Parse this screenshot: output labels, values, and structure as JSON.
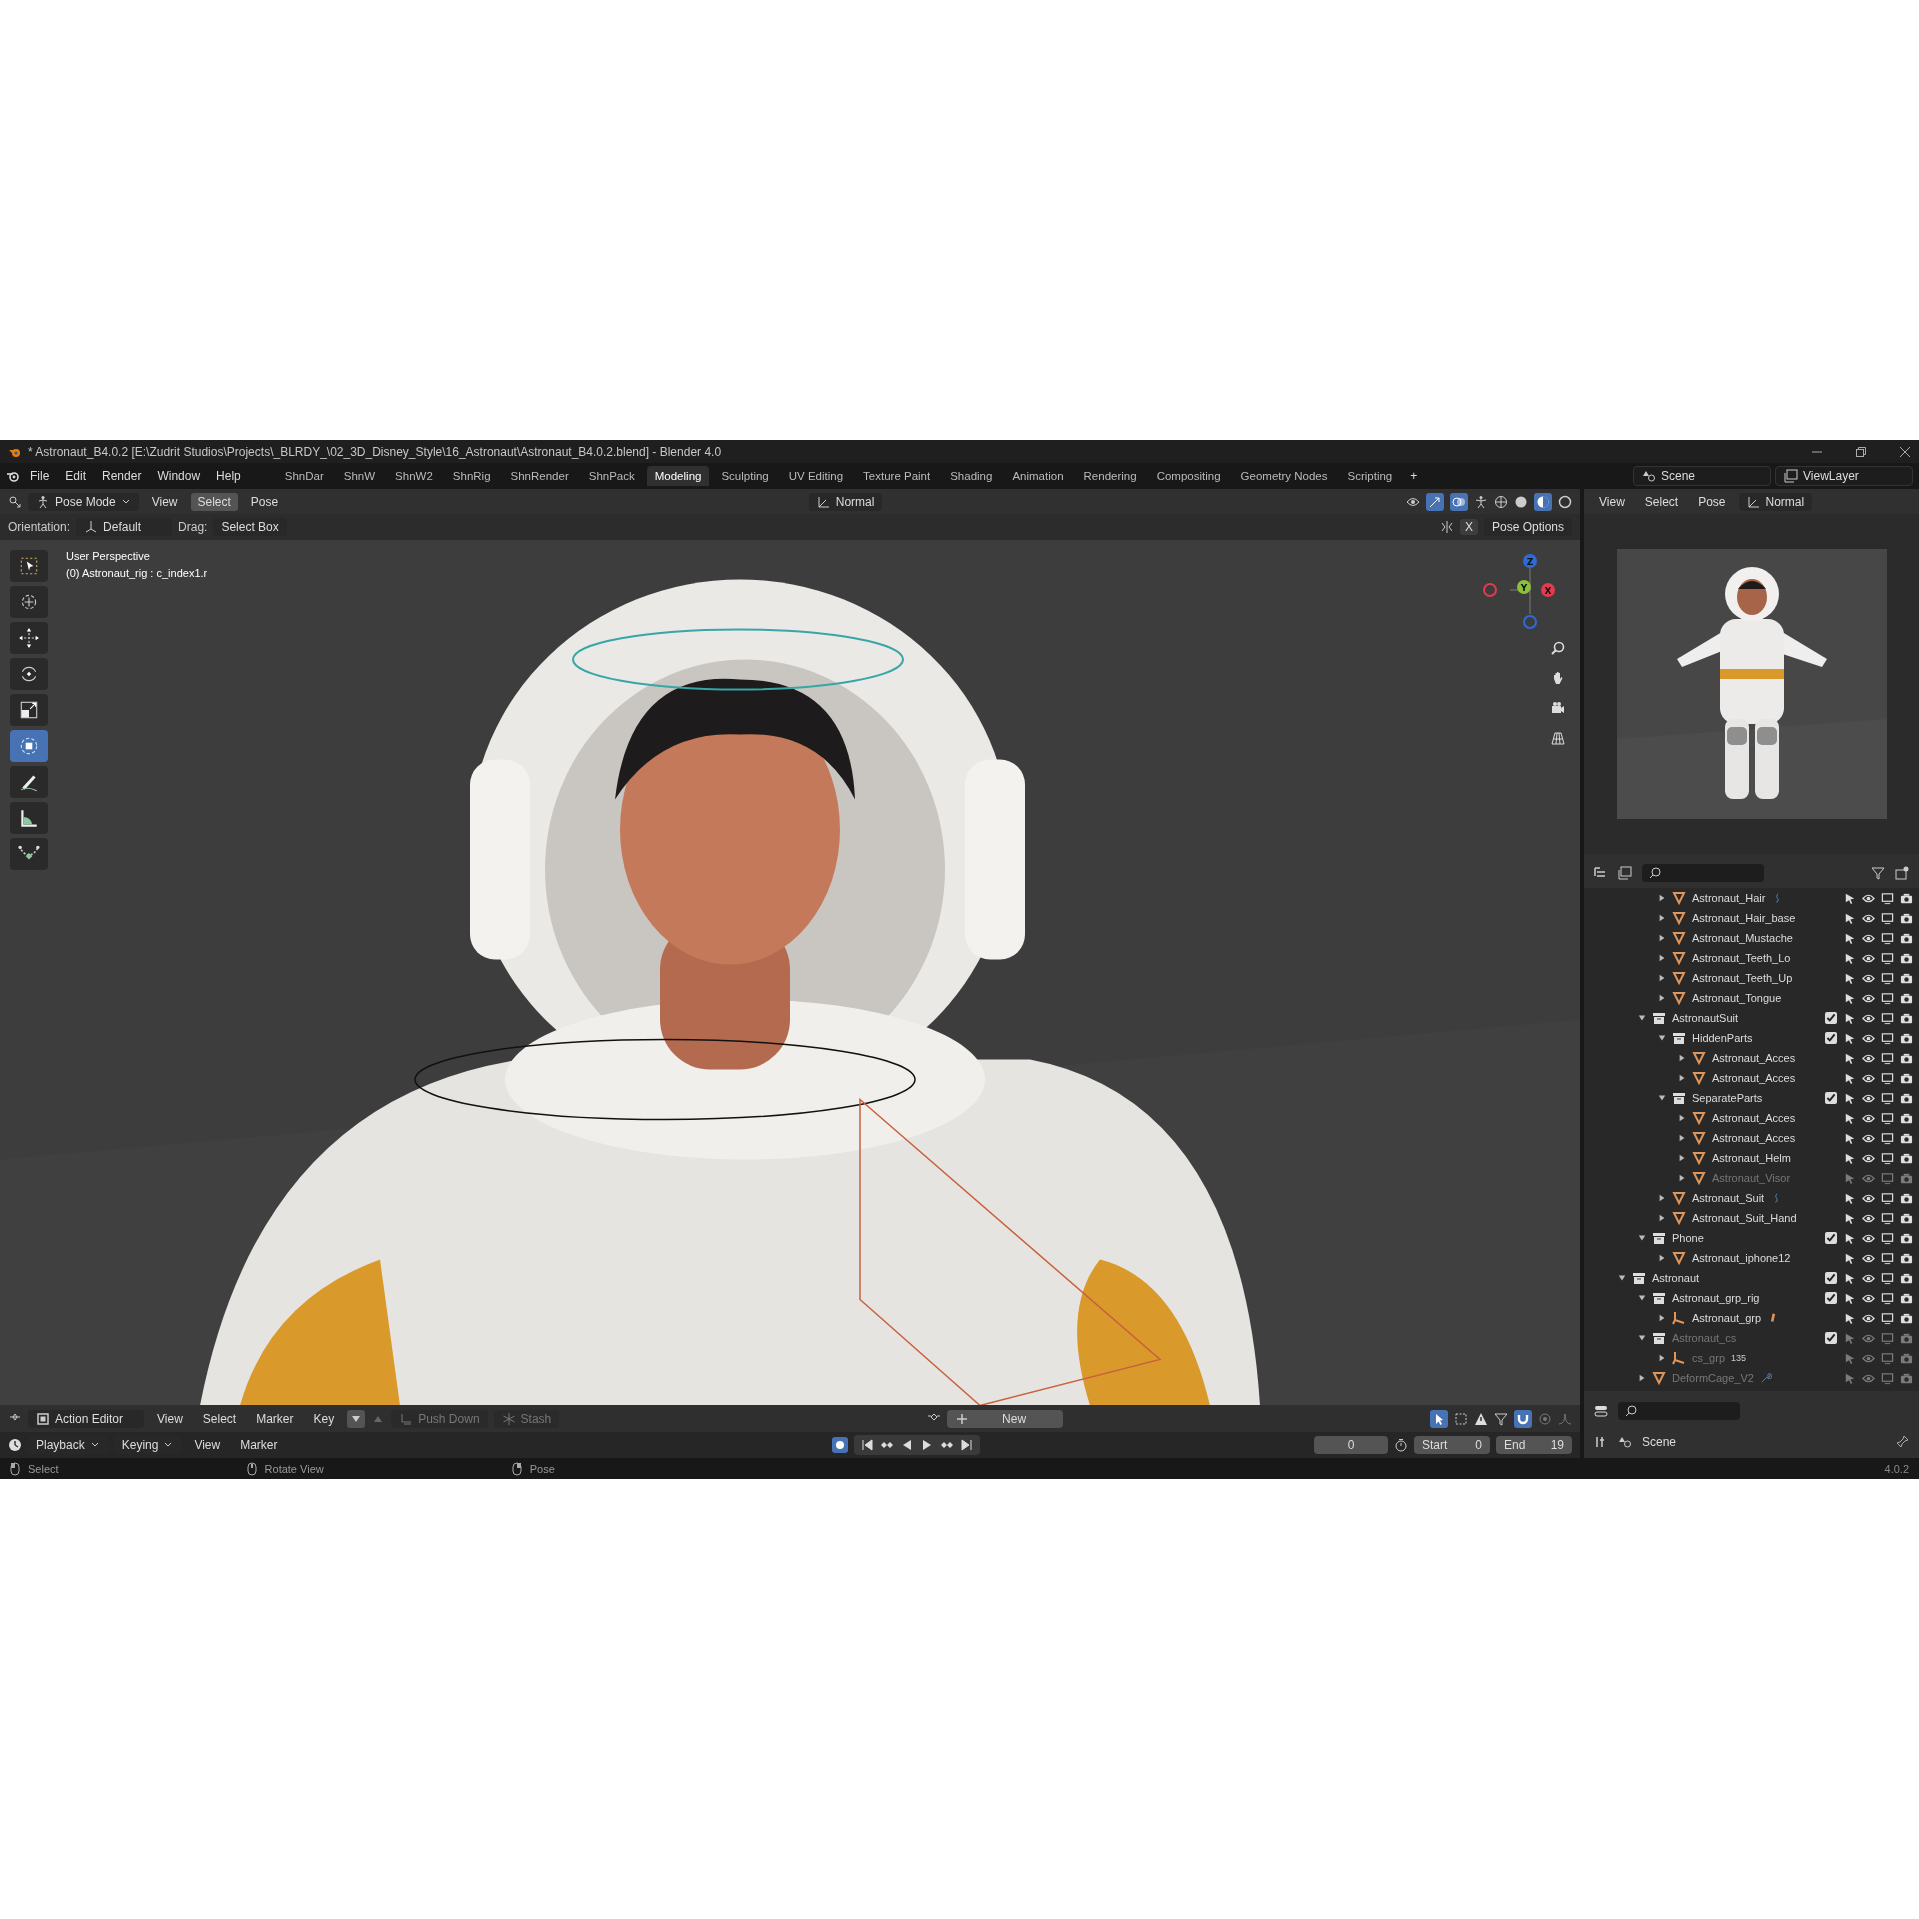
{
  "title_bar": {
    "title": "* Astronaut_B4.0.2 [E:\\Zudrit Studios\\Projects\\_BLRDY_\\02_3D_Disney_Style\\16_Astronaut\\Astronaut_B4.0.2.blend] - Blender 4.0"
  },
  "menu": [
    "File",
    "Edit",
    "Render",
    "Window",
    "Help"
  ],
  "workspaces": [
    {
      "label": "ShnDar",
      "selected": false
    },
    {
      "label": "ShnW",
      "selected": false
    },
    {
      "label": "ShnW2",
      "selected": false
    },
    {
      "label": "ShnRig",
      "selected": false
    },
    {
      "label": "ShnRender",
      "selected": false
    },
    {
      "label": "ShnPack",
      "selected": false
    },
    {
      "label": "Modeling",
      "selected": true
    },
    {
      "label": "Sculpting",
      "selected": false
    },
    {
      "label": "UV Editing",
      "selected": false
    },
    {
      "label": "Texture Paint",
      "selected": false
    },
    {
      "label": "Shading",
      "selected": false
    },
    {
      "label": "Animation",
      "selected": false
    },
    {
      "label": "Rendering",
      "selected": false
    },
    {
      "label": "Compositing",
      "selected": false
    },
    {
      "label": "Geometry Nodes",
      "selected": false
    },
    {
      "label": "Scripting",
      "selected": false
    }
  ],
  "add_workspace": "+",
  "scene": "Scene",
  "view_layer": "ViewLayer",
  "viewport_header": {
    "mode": "Pose Mode",
    "menus": [
      {
        "label": "View",
        "selected": false
      },
      {
        "label": "Select",
        "selected": true
      },
      {
        "label": "Pose",
        "selected": false
      }
    ],
    "orientation": "Normal"
  },
  "tool_settings": {
    "orientation_label": "Orientation:",
    "orientation": "Default",
    "drag_label": "Drag:",
    "drag": "Select Box",
    "mirror": "X",
    "pose_options": "Pose Options"
  },
  "tools": [
    {
      "kind": "select",
      "selected": false
    },
    {
      "kind": "cursor",
      "selected": false
    },
    {
      "kind": "move",
      "selected": false
    },
    {
      "kind": "rotate",
      "selected": false
    },
    {
      "kind": "scale",
      "selected": false
    },
    {
      "kind": "transform",
      "selected": true
    },
    {
      "kind": "annotate",
      "selected": false
    },
    {
      "kind": "measure",
      "selected": false
    },
    {
      "kind": "roll",
      "selected": false
    }
  ],
  "viewport": {
    "view_name": "User Perspective",
    "active_bone": "(0) Astronaut_rig : c_index1.r",
    "gizmo_axes": [
      "Z",
      "Y",
      "X"
    ]
  },
  "preview_header": {
    "menus": [
      "View",
      "Select",
      "Pose"
    ],
    "orientation": "Normal"
  },
  "outliner": {
    "items": [
      {
        "children": [
          {
            "children": [
              {
                "children": [
                  {
                    "label": "Astronaut_Hair",
                    "kind": "mesh",
                    "expanded": false,
                    "extra": {
                      "kind": "hook"
                    }
                  },
                  {
                    "label": "Astronaut_Hair_base",
                    "kind": "mesh",
                    "expanded": false
                  },
                  {
                    "label": "Astronaut_Mustache",
                    "kind": "mesh",
                    "expanded": false
                  },
                  {
                    "label": "Astronaut_Teeth_Lo",
                    "kind": "mesh",
                    "expanded": false
                  },
                  {
                    "label": "Astronaut_Teeth_Up",
                    "kind": "mesh",
                    "expanded": false
                  },
                  {
                    "label": "Astronaut_Tongue",
                    "kind": "mesh",
                    "expanded": false
                  }
                ]
              },
              {
                "label": "AstronautSuit",
                "kind": "collection",
                "expanded": true,
                "checked": true,
                "children": [
                  {
                    "label": "HiddenParts",
                    "kind": "collection",
                    "expanded": true,
                    "checked": true,
                    "children": [
                      {
                        "label": "Astronaut_Acces",
                        "kind": "mesh",
                        "expanded": false
                      },
                      {
                        "label": "Astronaut_Acces",
                        "kind": "mesh",
                        "expanded": false
                      }
                    ]
                  },
                  {
                    "label": "SeparateParts",
                    "kind": "collection",
                    "expanded": true,
                    "checked": true,
                    "children": [
                      {
                        "label": "Astronaut_Acces",
                        "kind": "mesh",
                        "expanded": false
                      },
                      {
                        "label": "Astronaut_Acces",
                        "kind": "mesh",
                        "expanded": false
                      },
                      {
                        "label": "Astronaut_Helm",
                        "kind": "mesh",
                        "expanded": false
                      },
                      {
                        "label": "Astronaut_Visor",
                        "kind": "mesh",
                        "expanded": false,
                        "disabled": true
                      }
                    ]
                  },
                  {
                    "label": "Astronaut_Suit",
                    "kind": "mesh",
                    "expanded": false,
                    "extra": {
                      "kind": "hook"
                    }
                  },
                  {
                    "label": "Astronaut_Suit_Hand",
                    "kind": "mesh",
                    "expanded": false
                  }
                ]
              },
              {
                "label": "Phone",
                "kind": "collection",
                "expanded": true,
                "checked": true,
                "children": [
                  {
                    "label": "Astronaut_iphone12",
                    "kind": "mesh",
                    "expanded": false
                  }
                ]
              }
            ]
          },
          {
            "label": "Astronaut",
            "kind": "collection",
            "expanded": true,
            "checked": true,
            "children": [
              {
                "label": "Astronaut_grp_rig",
                "kind": "collection",
                "expanded": true,
                "checked": true,
                "children": [
                  {
                    "label": "Astronaut_grp",
                    "kind": "armature",
                    "expanded": false,
                    "extra": {
                      "kind": "bone"
                    }
                  }
                ]
              },
              {
                "label": "Astronaut_cs",
                "kind": "collection",
                "expanded": true,
                "checked": true,
                "disabled": true,
                "children": [
                  {
                    "label": "cs_grp",
                    "kind": "armature",
                    "expanded": false,
                    "disabled": true,
                    "badge": "135"
                  }
                ]
              },
              {
                "label": "DeformCage_V2",
                "kind": "mesh",
                "expanded": false,
                "disabled": true,
                "extra": {
                  "kind": "wrench"
                }
              }
            ]
          }
        ]
      }
    ]
  },
  "action_editor": {
    "editor": "Action Editor",
    "menus": [
      "View",
      "Select",
      "Marker",
      "Key"
    ],
    "push_down": "Push Down",
    "stash": "Stash",
    "new": "New"
  },
  "timeline": {
    "menus": [
      {
        "label": "Playback",
        "kind": "dropdown"
      },
      {
        "label": "Keying",
        "kind": "dropdown"
      },
      {
        "label": "View",
        "kind": "menu"
      },
      {
        "label": "Marker",
        "kind": "menu"
      }
    ],
    "auto_key": true,
    "current_frame": "0",
    "start_label": "Start",
    "start": "0",
    "end_label": "End",
    "end": "19"
  },
  "properties": {
    "context": "Scene"
  },
  "status_bar": {
    "hints": [
      {
        "kind": "left",
        "label": "Select"
      },
      {
        "kind": "middle",
        "label": "Rotate View"
      },
      {
        "kind": "right",
        "label": "Pose"
      }
    ],
    "version": "4.0.2"
  }
}
